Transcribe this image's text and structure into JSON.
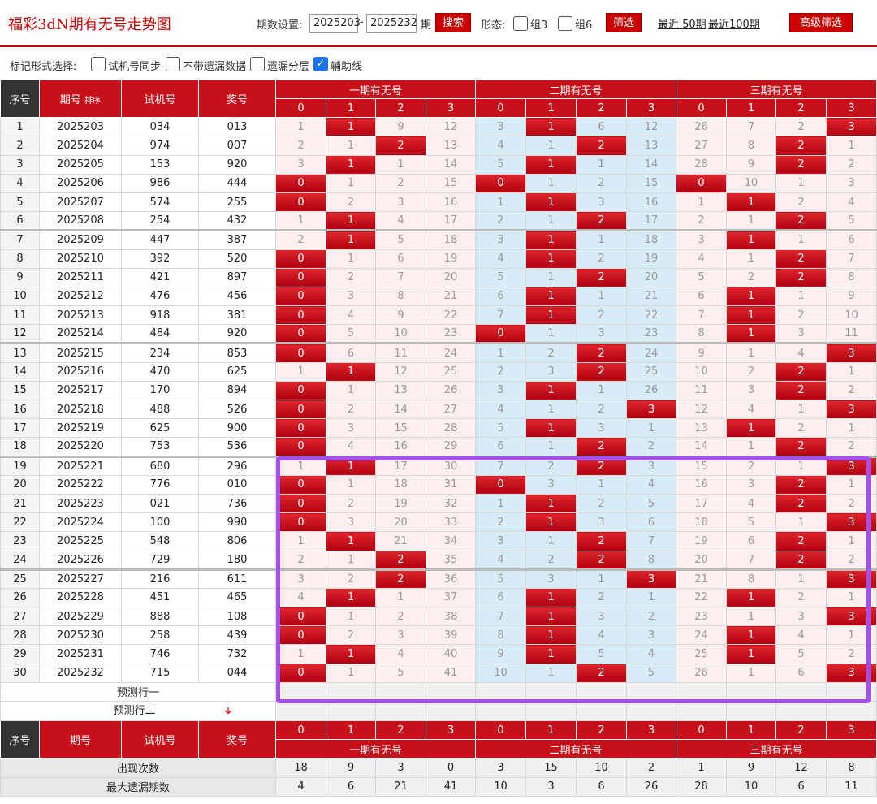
{
  "header": {
    "title": "福彩3dN期有无号走势图",
    "period_label": "期数设置:",
    "period_from": "2025203",
    "period_dash": "-",
    "period_to": "2025232",
    "period_unit": "期",
    "search_label": "搜索",
    "form_label": "形态:",
    "group3_label": "组3",
    "group6_label": "组6",
    "filter_label": "筛选",
    "recent50_label": "最近 50期",
    "recent100_label": "最近100期",
    "advanced_label": "高级筛选"
  },
  "options": {
    "mark_label": "标记形式选择:",
    "items": [
      {
        "label": "试机号同步",
        "checked": false
      },
      {
        "label": "不带遗漏数据",
        "checked": false
      },
      {
        "label": "遗漏分层",
        "checked": false
      },
      {
        "label": "辅助线",
        "checked": true
      }
    ]
  },
  "table": {
    "headers": {
      "seq": "序号",
      "issue": "期号",
      "sort": "排序",
      "trial": "试机号",
      "prize": "奖号",
      "group1": "一期有无号",
      "group2": "二期有无号",
      "group3": "三期有无号"
    },
    "digits": [
      "0",
      "1",
      "2",
      "3"
    ],
    "rows": [
      {
        "seq": "1",
        "issue": "2025203",
        "trial": "034",
        "prize": "013",
        "g1": [
          "1",
          "1",
          "9",
          "12"
        ],
        "g2": [
          "3",
          "1",
          "6",
          "12"
        ],
        "g3": [
          "26",
          "7",
          "2",
          "3"
        ],
        "h1": 1,
        "h2": 1,
        "h3": 3
      },
      {
        "seq": "2",
        "issue": "2025204",
        "trial": "974",
        "prize": "007",
        "g1": [
          "2",
          "1",
          "2",
          "13"
        ],
        "g2": [
          "4",
          "1",
          "2",
          "13"
        ],
        "g3": [
          "27",
          "8",
          "2",
          "1"
        ],
        "h1": 2,
        "h2": 2,
        "h3": 2
      },
      {
        "seq": "3",
        "issue": "2025205",
        "trial": "153",
        "prize": "920",
        "g1": [
          "3",
          "1",
          "1",
          "14"
        ],
        "g2": [
          "5",
          "1",
          "1",
          "14"
        ],
        "g3": [
          "28",
          "9",
          "2",
          "2"
        ],
        "h1": 1,
        "h2": 1,
        "h3": 2
      },
      {
        "seq": "4",
        "issue": "2025206",
        "trial": "986",
        "prize": "444",
        "g1": [
          "0",
          "1",
          "2",
          "15"
        ],
        "g2": [
          "0",
          "1",
          "2",
          "15"
        ],
        "g3": [
          "0",
          "10",
          "1",
          "3"
        ],
        "h1": 0,
        "h2": 0,
        "h3": 0
      },
      {
        "seq": "5",
        "issue": "2025207",
        "trial": "574",
        "prize": "255",
        "g1": [
          "0",
          "2",
          "3",
          "16"
        ],
        "g2": [
          "1",
          "1",
          "3",
          "16"
        ],
        "g3": [
          "1",
          "1",
          "2",
          "4"
        ],
        "h1": 0,
        "h2": 1,
        "h3": 1
      },
      {
        "seq": "6",
        "issue": "2025208",
        "trial": "254",
        "prize": "432",
        "g1": [
          "1",
          "1",
          "4",
          "17"
        ],
        "g2": [
          "2",
          "1",
          "2",
          "17"
        ],
        "g3": [
          "2",
          "1",
          "2",
          "5"
        ],
        "h1": 1,
        "h2": 2,
        "h3": 2
      },
      {
        "seq": "7",
        "issue": "2025209",
        "trial": "447",
        "prize": "387",
        "g1": [
          "2",
          "1",
          "5",
          "18"
        ],
        "g2": [
          "3",
          "1",
          "1",
          "18"
        ],
        "g3": [
          "3",
          "1",
          "1",
          "6"
        ],
        "h1": 1,
        "h2": 1,
        "h3": 1
      },
      {
        "seq": "8",
        "issue": "2025210",
        "trial": "392",
        "prize": "520",
        "g1": [
          "0",
          "1",
          "6",
          "19"
        ],
        "g2": [
          "4",
          "1",
          "2",
          "19"
        ],
        "g3": [
          "4",
          "1",
          "2",
          "7"
        ],
        "h1": 0,
        "h2": 1,
        "h3": 2
      },
      {
        "seq": "9",
        "issue": "2025211",
        "trial": "421",
        "prize": "897",
        "g1": [
          "0",
          "2",
          "7",
          "20"
        ],
        "g2": [
          "5",
          "1",
          "2",
          "20"
        ],
        "g3": [
          "5",
          "2",
          "2",
          "8"
        ],
        "h1": 0,
        "h2": 2,
        "h3": 2
      },
      {
        "seq": "10",
        "issue": "2025212",
        "trial": "476",
        "prize": "456",
        "g1": [
          "0",
          "3",
          "8",
          "21"
        ],
        "g2": [
          "6",
          "1",
          "1",
          "21"
        ],
        "g3": [
          "6",
          "1",
          "1",
          "9"
        ],
        "h1": 0,
        "h2": 1,
        "h3": 1
      },
      {
        "seq": "11",
        "issue": "2025213",
        "trial": "918",
        "prize": "381",
        "g1": [
          "0",
          "4",
          "9",
          "22"
        ],
        "g2": [
          "7",
          "1",
          "2",
          "22"
        ],
        "g3": [
          "7",
          "1",
          "2",
          "10"
        ],
        "h1": 0,
        "h2": 1,
        "h3": 1
      },
      {
        "seq": "12",
        "issue": "2025214",
        "trial": "484",
        "prize": "920",
        "g1": [
          "0",
          "5",
          "10",
          "23"
        ],
        "g2": [
          "0",
          "1",
          "3",
          "23"
        ],
        "g3": [
          "8",
          "1",
          "3",
          "11"
        ],
        "h1": 0,
        "h2": 0,
        "h3": 1
      },
      {
        "seq": "13",
        "issue": "2025215",
        "trial": "234",
        "prize": "853",
        "g1": [
          "0",
          "6",
          "11",
          "24"
        ],
        "g2": [
          "1",
          "2",
          "2",
          "24"
        ],
        "g3": [
          "9",
          "1",
          "4",
          "3"
        ],
        "h1": 0,
        "h2": 2,
        "h3": 3
      },
      {
        "seq": "14",
        "issue": "2025216",
        "trial": "470",
        "prize": "625",
        "g1": [
          "1",
          "1",
          "12",
          "25"
        ],
        "g2": [
          "2",
          "3",
          "2",
          "25"
        ],
        "g3": [
          "10",
          "2",
          "2",
          "1"
        ],
        "h1": 1,
        "h2": 2,
        "h3": 2
      },
      {
        "seq": "15",
        "issue": "2025217",
        "trial": "170",
        "prize": "894",
        "g1": [
          "0",
          "1",
          "13",
          "26"
        ],
        "g2": [
          "3",
          "1",
          "1",
          "26"
        ],
        "g3": [
          "11",
          "3",
          "2",
          "2"
        ],
        "h1": 0,
        "h2": 1,
        "h3": 2
      },
      {
        "seq": "16",
        "issue": "2025218",
        "trial": "488",
        "prize": "526",
        "g1": [
          "0",
          "2",
          "14",
          "27"
        ],
        "g2": [
          "4",
          "1",
          "2",
          "3"
        ],
        "g3": [
          "12",
          "4",
          "1",
          "3"
        ],
        "h1": 0,
        "h2": 3,
        "h3": 3
      },
      {
        "seq": "17",
        "issue": "2025219",
        "trial": "625",
        "prize": "900",
        "g1": [
          "0",
          "3",
          "15",
          "28"
        ],
        "g2": [
          "5",
          "1",
          "3",
          "1"
        ],
        "g3": [
          "13",
          "1",
          "2",
          "1"
        ],
        "h1": 0,
        "h2": 1,
        "h3": 1
      },
      {
        "seq": "18",
        "issue": "2025220",
        "trial": "753",
        "prize": "536",
        "g1": [
          "0",
          "4",
          "16",
          "29"
        ],
        "g2": [
          "6",
          "1",
          "2",
          "2"
        ],
        "g3": [
          "14",
          "1",
          "2",
          "2"
        ],
        "h1": 0,
        "h2": 2,
        "h3": 2
      },
      {
        "seq": "19",
        "issue": "2025221",
        "trial": "680",
        "prize": "296",
        "g1": [
          "1",
          "1",
          "17",
          "30"
        ],
        "g2": [
          "7",
          "2",
          "2",
          "3"
        ],
        "g3": [
          "15",
          "2",
          "1",
          "3"
        ],
        "h1": 1,
        "h2": 2,
        "h3": 3
      },
      {
        "seq": "20",
        "issue": "2025222",
        "trial": "776",
        "prize": "010",
        "g1": [
          "0",
          "1",
          "18",
          "31"
        ],
        "g2": [
          "0",
          "3",
          "1",
          "4"
        ],
        "g3": [
          "16",
          "3",
          "2",
          "1"
        ],
        "h1": 0,
        "h2": 0,
        "h3": 2
      },
      {
        "seq": "21",
        "issue": "2025223",
        "trial": "021",
        "prize": "736",
        "g1": [
          "0",
          "2",
          "19",
          "32"
        ],
        "g2": [
          "1",
          "1",
          "2",
          "5"
        ],
        "g3": [
          "17",
          "4",
          "2",
          "2"
        ],
        "h1": 0,
        "h2": 1,
        "h3": 2
      },
      {
        "seq": "22",
        "issue": "2025224",
        "trial": "100",
        "prize": "990",
        "g1": [
          "0",
          "3",
          "20",
          "33"
        ],
        "g2": [
          "2",
          "1",
          "3",
          "6"
        ],
        "g3": [
          "18",
          "5",
          "1",
          "3"
        ],
        "h1": 0,
        "h2": 1,
        "h3": 3
      },
      {
        "seq": "23",
        "issue": "2025225",
        "trial": "548",
        "prize": "806",
        "g1": [
          "1",
          "1",
          "21",
          "34"
        ],
        "g2": [
          "3",
          "1",
          "2",
          "7"
        ],
        "g3": [
          "19",
          "6",
          "2",
          "1"
        ],
        "h1": 1,
        "h2": 2,
        "h3": 2
      },
      {
        "seq": "24",
        "issue": "2025226",
        "trial": "729",
        "prize": "180",
        "g1": [
          "2",
          "1",
          "2",
          "35"
        ],
        "g2": [
          "4",
          "2",
          "2",
          "8"
        ],
        "g3": [
          "20",
          "7",
          "2",
          "2"
        ],
        "h1": 2,
        "h2": 2,
        "h3": 2
      },
      {
        "seq": "25",
        "issue": "2025227",
        "trial": "216",
        "prize": "611",
        "g1": [
          "3",
          "2",
          "2",
          "36"
        ],
        "g2": [
          "5",
          "3",
          "1",
          "3"
        ],
        "g3": [
          "21",
          "8",
          "1",
          "3"
        ],
        "h1": 2,
        "h2": 3,
        "h3": 3
      },
      {
        "seq": "26",
        "issue": "2025228",
        "trial": "451",
        "prize": "465",
        "g1": [
          "4",
          "1",
          "1",
          "37"
        ],
        "g2": [
          "6",
          "1",
          "2",
          "1"
        ],
        "g3": [
          "22",
          "1",
          "2",
          "1"
        ],
        "h1": 1,
        "h2": 1,
        "h3": 1
      },
      {
        "seq": "27",
        "issue": "2025229",
        "trial": "888",
        "prize": "108",
        "g1": [
          "0",
          "1",
          "2",
          "38"
        ],
        "g2": [
          "7",
          "1",
          "3",
          "2"
        ],
        "g3": [
          "23",
          "1",
          "3",
          "3"
        ],
        "h1": 0,
        "h2": 1,
        "h3": 3
      },
      {
        "seq": "28",
        "issue": "2025230",
        "trial": "258",
        "prize": "439",
        "g1": [
          "0",
          "2",
          "3",
          "39"
        ],
        "g2": [
          "8",
          "1",
          "4",
          "3"
        ],
        "g3": [
          "24",
          "1",
          "4",
          "1"
        ],
        "h1": 0,
        "h2": 1,
        "h3": 1
      },
      {
        "seq": "29",
        "issue": "2025231",
        "trial": "746",
        "prize": "732",
        "g1": [
          "1",
          "1",
          "4",
          "40"
        ],
        "g2": [
          "9",
          "1",
          "5",
          "4"
        ],
        "g3": [
          "25",
          "1",
          "5",
          "2"
        ],
        "h1": 1,
        "h2": 1,
        "h3": 1
      },
      {
        "seq": "30",
        "issue": "2025232",
        "trial": "715",
        "prize": "044",
        "g1": [
          "0",
          "1",
          "5",
          "41"
        ],
        "g2": [
          "10",
          "1",
          "2",
          "5"
        ],
        "g3": [
          "26",
          "1",
          "6",
          "3"
        ],
        "h1": 0,
        "h2": 2,
        "h3": 3
      }
    ],
    "predict1": "预测行一",
    "predict2": "预测行二",
    "stats": [
      {
        "label": "出现次数",
        "values": [
          "18",
          "9",
          "3",
          "0",
          "3",
          "15",
          "10",
          "2",
          "1",
          "9",
          "12",
          "8"
        ]
      },
      {
        "label": "最大遗漏期数",
        "values": [
          "4",
          "6",
          "21",
          "41",
          "10",
          "3",
          "6",
          "26",
          "28",
          "10",
          "6",
          "11"
        ]
      }
    ]
  }
}
